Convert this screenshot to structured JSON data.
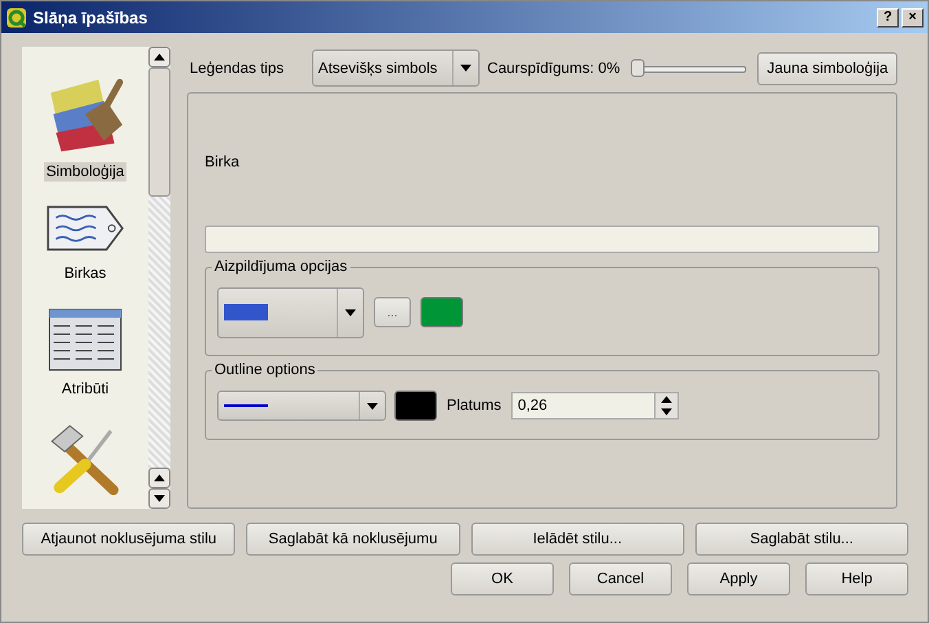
{
  "window": {
    "title": "Slāņa īpašības",
    "buttons": [
      "?",
      "×"
    ]
  },
  "sidebar": {
    "items": [
      {
        "label": "Simboloģija",
        "kind": "brush",
        "selected": true
      },
      {
        "label": "Birkas",
        "kind": "tag",
        "selected": false
      },
      {
        "label": "Atribūti",
        "kind": "table",
        "selected": false
      },
      {
        "kind": "tools",
        "selected": false
      }
    ]
  },
  "legend": {
    "label": "Leģendas tips",
    "value": "Atsevišķs simbols",
    "transparency_label": "Caurspīdīgums: 0%",
    "transparency": {
      "level": 0
    },
    "new_button": "Jauna simboloģija"
  },
  "label_field": {
    "label": "Birka"
  },
  "fill": {
    "title": "Aizpildījuma opcijas",
    "more_button": "...",
    "color": "#009638"
  },
  "outline": {
    "title": "Outline options",
    "color": "#000000",
    "width_label": "Platums",
    "width_value": "0,26"
  },
  "style_buttons": [
    "Atjaunot noklusējuma stilu",
    "Saglabāt kā noklusējumu",
    "Ielādēt stilu...",
    "Saglabāt stilu..."
  ],
  "buttons": [
    "OK",
    "Cancel",
    "Apply",
    "Help"
  ]
}
